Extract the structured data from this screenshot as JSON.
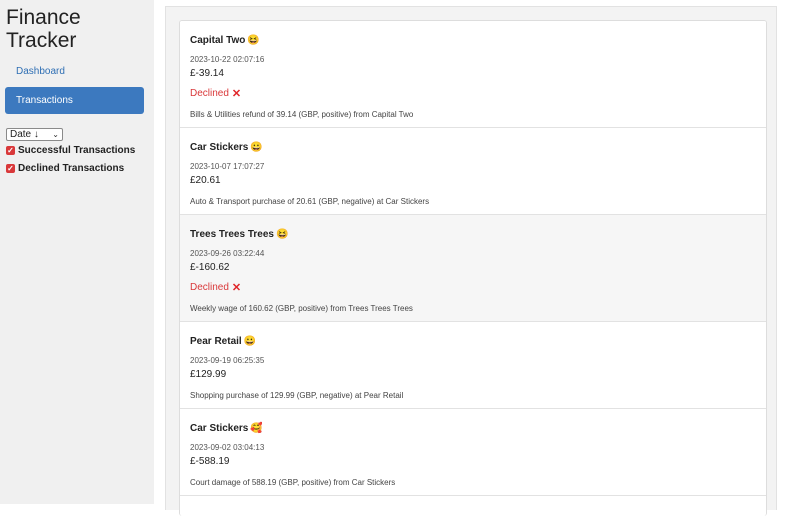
{
  "app": {
    "title_line1": "Finance",
    "title_line2": "Tracker"
  },
  "nav": {
    "dashboard": "Dashboard",
    "transactions": "Transactions"
  },
  "sort": {
    "selected": "Date ↓"
  },
  "filters": [
    {
      "label": "Successful Transactions",
      "checked": true
    },
    {
      "label": "Declined Transactions",
      "checked": true
    }
  ],
  "transactions": [
    {
      "name": "Capital Two",
      "emoji": "😆",
      "datetime": "2023-10-22 02:07:16",
      "amount": "£-39.14",
      "status": "Declined",
      "status_icon": "cross-icon",
      "description": "Bills & Utilities refund of 39.14 (GBP, positive) from Capital Two"
    },
    {
      "name": "Car Stickers",
      "emoji": "😀",
      "datetime": "2023-10-07 17:07:27",
      "amount": "£20.61",
      "status": "",
      "status_icon": "",
      "description": "Auto & Transport purchase of 20.61 (GBP, negative) at Car Stickers"
    },
    {
      "name": "Trees Trees Trees",
      "emoji": "😆",
      "datetime": "2023-09-26 03:22:44",
      "amount": "£-160.62",
      "status": "Declined",
      "status_icon": "cross-icon",
      "description": "Weekly wage of 160.62 (GBP, positive) from Trees Trees Trees"
    },
    {
      "name": "Pear Retail",
      "emoji": "😀",
      "datetime": "2023-09-19 06:25:35",
      "amount": "£129.99",
      "status": "",
      "status_icon": "",
      "description": "Shopping purchase of 129.99 (GBP, negative) at Pear Retail"
    },
    {
      "name": "Car Stickers",
      "emoji": "🥰",
      "datetime": "2023-09-02 03:04:13",
      "amount": "£-588.19",
      "status": "",
      "status_icon": "",
      "description": "Court damage of 588.19 (GBP, positive) from Car Stickers"
    }
  ],
  "colors": {
    "accent": "#3c79bf",
    "declined": "#d9383a",
    "sidebar_bg": "#f0f0f0",
    "main_bg": "#f3f3f3"
  }
}
